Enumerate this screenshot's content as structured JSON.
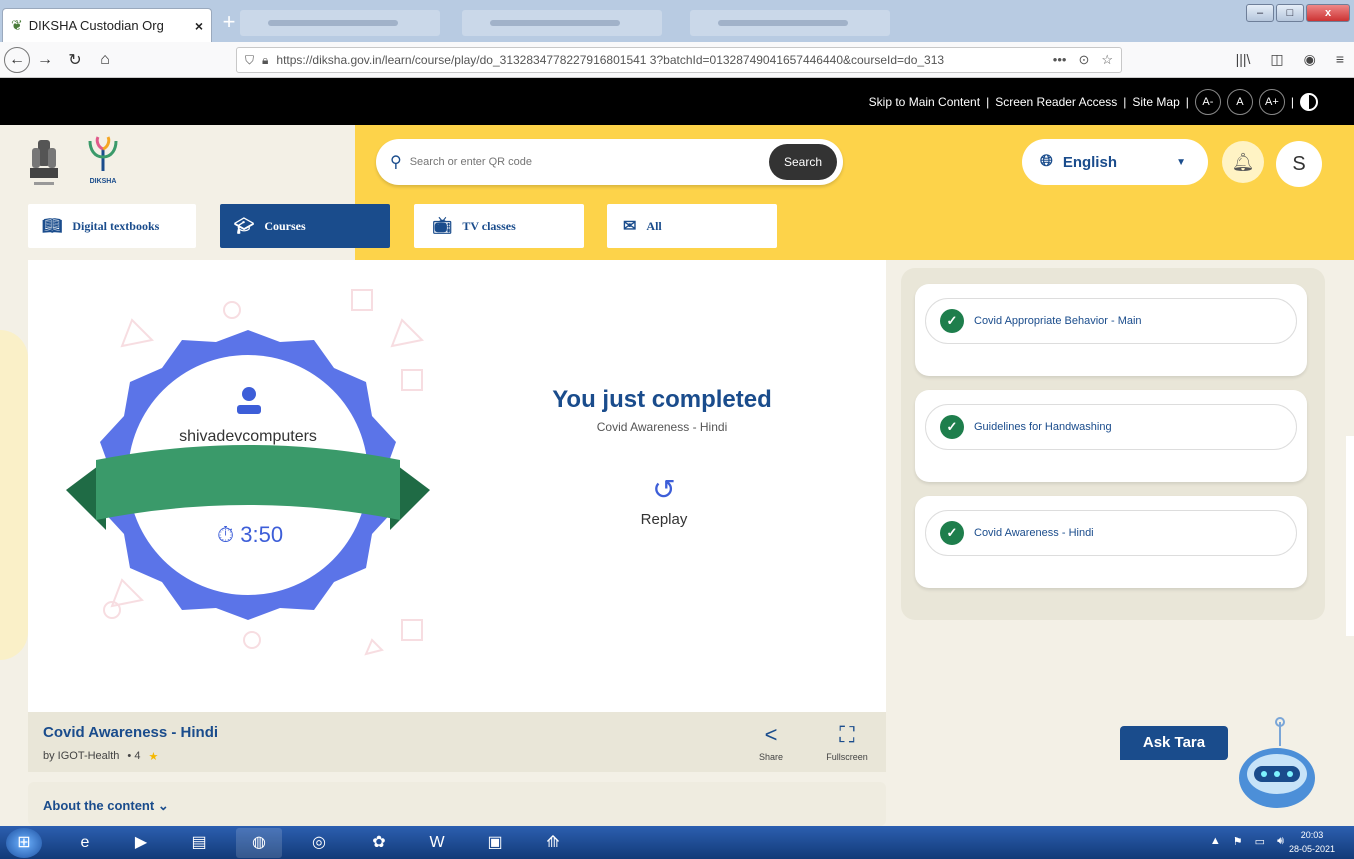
{
  "browser": {
    "tab_title": "DIKSHA Custodian Org",
    "tab_close": "×",
    "new_tab": "+",
    "url": "https://diksha.gov.in/learn/course/play/do_3132834778227916801541 3?batchId=01328749041657446440&courseId=do_313",
    "more": "•••"
  },
  "access_bar": {
    "skip": "Skip to Main Content",
    "screen_reader": "Screen Reader Access",
    "site_map": "Site Map",
    "sep": "|",
    "font_minus": "A-",
    "font_normal": "A",
    "font_plus": "A+"
  },
  "header": {
    "logo_text": "DIKSHA",
    "search_placeholder": "Search or enter QR code",
    "search_button": "Search",
    "language": "English",
    "avatar_initial": "S"
  },
  "category_tabs": [
    {
      "label": "Digital textbooks",
      "icon": "book-icon"
    },
    {
      "label": "Courses",
      "icon": "graduation-cap-icon"
    },
    {
      "label": "TV classes",
      "icon": "tv-icon"
    },
    {
      "label": "All",
      "icon": "inbox-icon"
    }
  ],
  "completion": {
    "user_name": "shivadevcomputers",
    "time": "3:50",
    "title": "You just completed",
    "subtitle": "Covid Awareness - Hindi",
    "replay": "Replay"
  },
  "course": {
    "title": "Covid Awareness - Hindi",
    "author": "by IGOT-Health",
    "rating": "• 4",
    "share": "Share",
    "fullscreen": "Fullscreen",
    "about": "About the content"
  },
  "units": [
    {
      "label": "Covid Appropriate Behavior - Main"
    },
    {
      "label": "Guidelines for Handwashing"
    },
    {
      "label": "Covid Awareness - Hindi"
    }
  ],
  "assistant": {
    "label": "Ask Tara"
  },
  "taskbar": {
    "time": "20:03",
    "date": "28-05-2021"
  },
  "colors": {
    "brand_blue": "#1a4c8c",
    "header_yellow": "#fdd34a",
    "badge_blue": "#5b74e8",
    "ribbon_green": "#3a9a6a",
    "check_green": "#1e7e4c"
  }
}
